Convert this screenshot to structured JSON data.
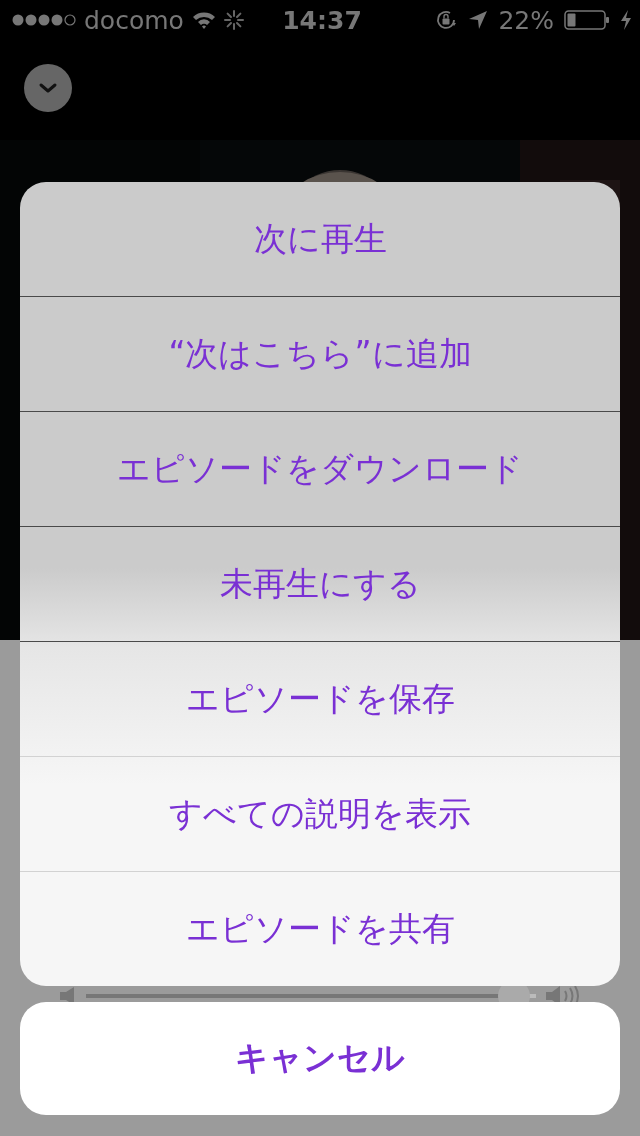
{
  "status_bar": {
    "carrier": "docomo",
    "time": "14:37",
    "battery": "22%"
  },
  "player": {
    "volume": {
      "level": 0.95
    }
  },
  "action_sheet": {
    "actions": [
      {
        "label": "次に再生"
      },
      {
        "label": "“次はこちら”に追加"
      },
      {
        "label": "エピソードをダウンロード"
      },
      {
        "label": "未再生にする"
      },
      {
        "label": "エピソードを保存"
      },
      {
        "label": "すべての説明を表示"
      },
      {
        "label": "エピソードを共有"
      }
    ],
    "cancel": "キャンセル"
  }
}
